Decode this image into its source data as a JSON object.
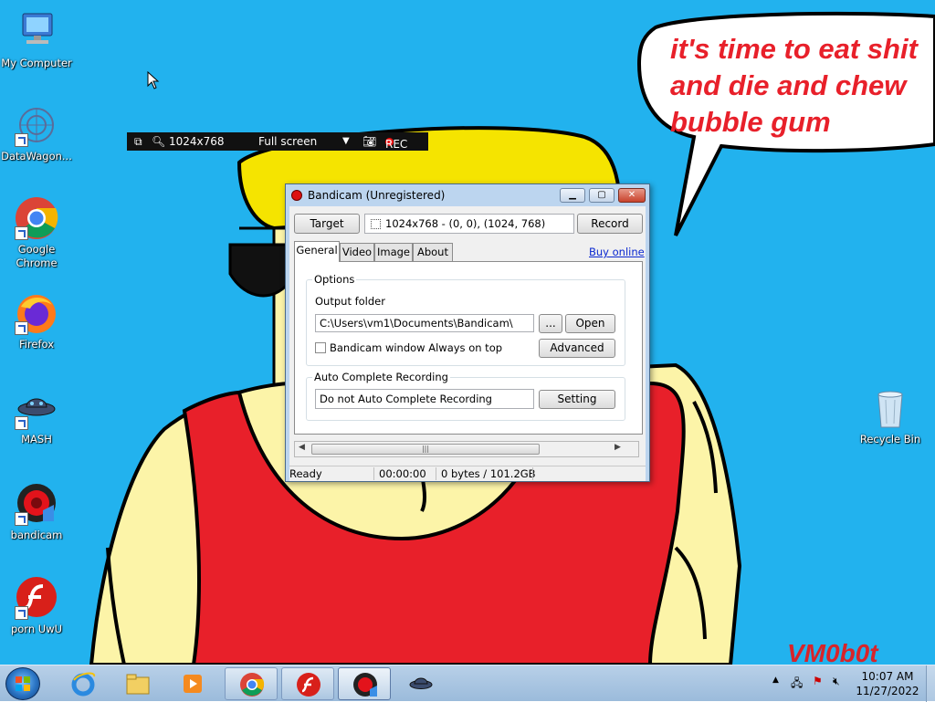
{
  "wallpaper": {
    "speech": [
      "it's time to eat shit",
      "and die and chew",
      "bubble gum"
    ],
    "signature": "VM0b0t",
    "colors": {
      "sky": "#22b2ee",
      "hair": "#f5e400",
      "shirt": "#e8202a",
      "skin": "#fcf4a8"
    }
  },
  "desktop_icons": [
    {
      "name": "my-computer-icon",
      "label": "My Computer"
    },
    {
      "name": "datawagon-icon",
      "label": "DataWagon..."
    },
    {
      "name": "google-chrome-icon",
      "label": "Google Chrome"
    },
    {
      "name": "firefox-icon",
      "label": "Firefox"
    },
    {
      "name": "mash-icon",
      "label": "MASH"
    },
    {
      "name": "bandicam-icon",
      "label": "bandicam"
    },
    {
      "name": "flash-icon",
      "label": "porn UwU"
    },
    {
      "name": "recycle-bin-icon",
      "label": "Recycle Bin"
    }
  ],
  "capture_bar": {
    "size": "1024x768",
    "mode": "Full screen",
    "rec": "REC"
  },
  "bandicam": {
    "title": "Bandicam (Unregistered)",
    "target_label": "Target",
    "target_value": "1024x768 - (0, 0), (1024, 768)",
    "record_label": "Record",
    "tabs": [
      "General",
      "Video",
      "Image",
      "About"
    ],
    "active_tab": "General",
    "buy_online": "Buy online",
    "options": {
      "group_label": "Options",
      "output_folder_label": "Output folder",
      "output_folder_value": "C:\\Users\\vm1\\Documents\\Bandicam\\",
      "browse_label": "...",
      "open_label": "Open",
      "always_on_top_label": "Bandicam window Always on top",
      "always_on_top_checked": false,
      "advanced_label": "Advanced"
    },
    "auto_complete": {
      "group_label": "Auto Complete Recording",
      "value": "Do not Auto Complete Recording",
      "setting_label": "Setting"
    },
    "status": {
      "state": "Ready",
      "time": "00:00:00",
      "size": "0 bytes / 101.2GB"
    }
  },
  "taskbar": {
    "items": [
      "start-button",
      "internet-explorer",
      "file-explorer",
      "media-player",
      "google-chrome",
      "flash-player",
      "bandicam",
      "mash"
    ],
    "clock_time": "10:07 AM",
    "clock_date": "11/27/2022"
  }
}
